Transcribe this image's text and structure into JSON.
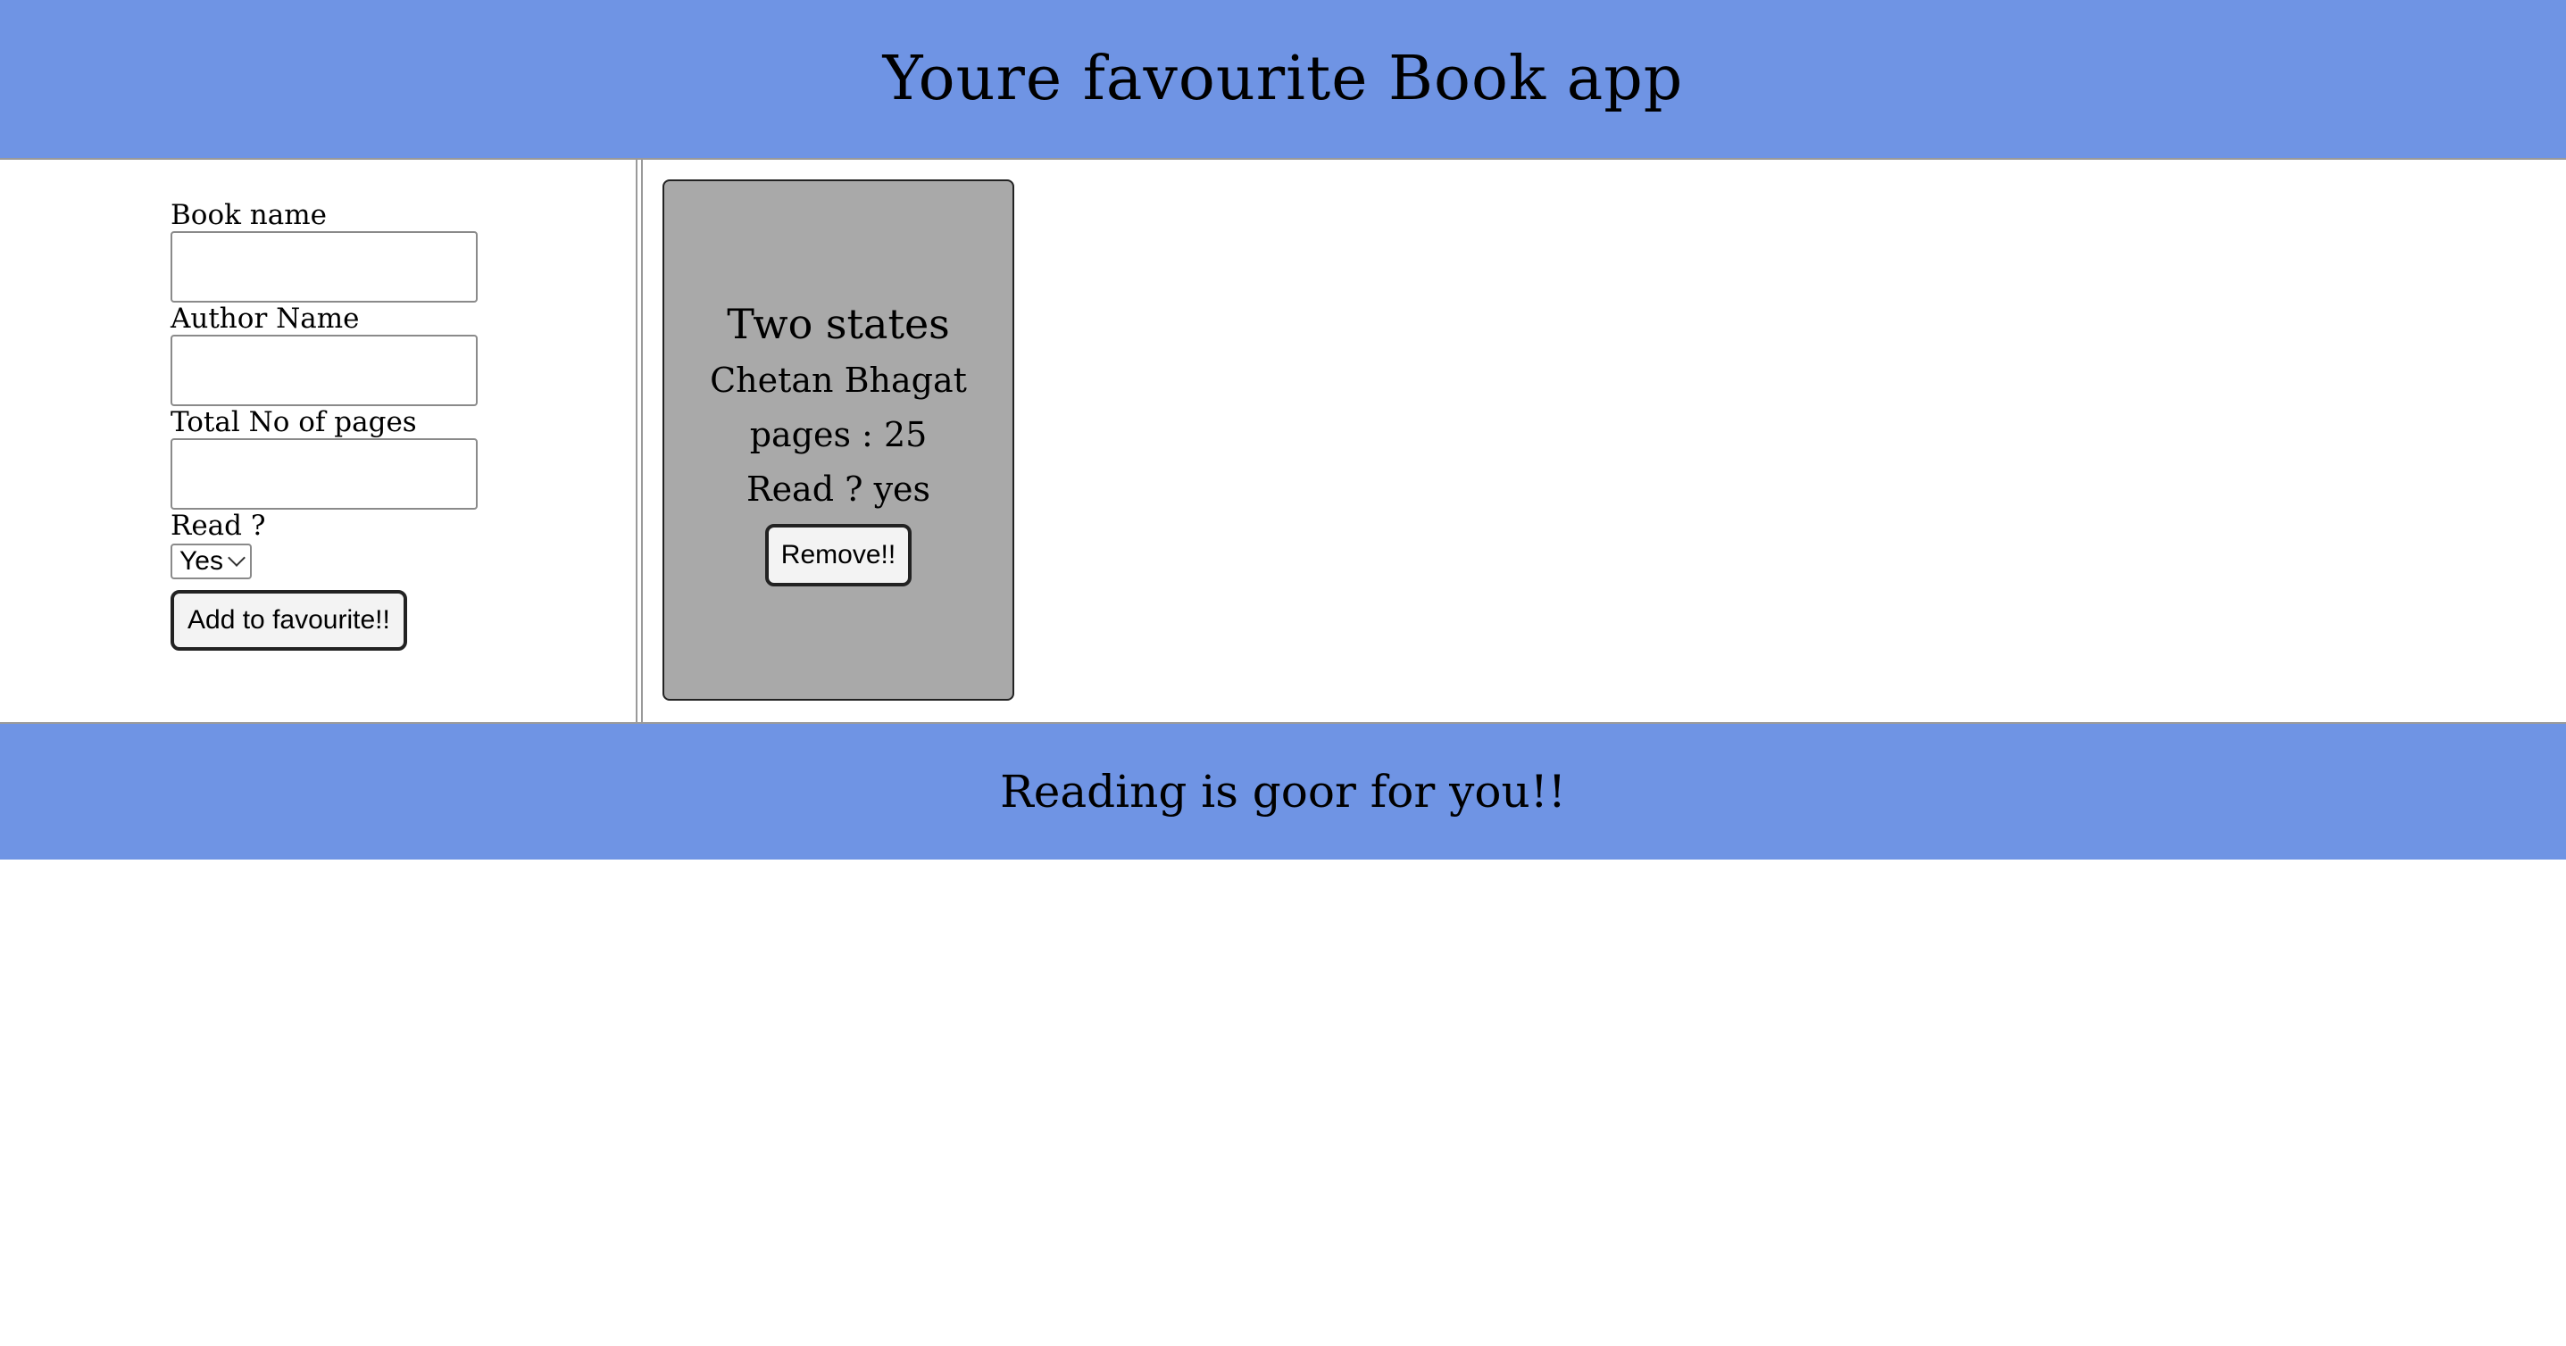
{
  "header": {
    "title": "Youre favourite Book app"
  },
  "form": {
    "book_label": "Book name",
    "book_value": "",
    "author_label": "Author Name",
    "author_value": "",
    "pages_label": "Total No of pages",
    "pages_value": "",
    "read_label": "Read ?",
    "read_selected": "Yes",
    "submit_label": "Add to favourite!!"
  },
  "books": [
    {
      "title": "Two states",
      "author": "Chetan Bhagat",
      "pages_text": "pages : 25",
      "read_text": "Read ? yes",
      "remove_label": "Remove!!"
    }
  ],
  "footer": {
    "text": "Reading is goor for you!!"
  },
  "colors": {
    "accent": "#6f94e4",
    "card_bg": "#a9a9a9"
  }
}
